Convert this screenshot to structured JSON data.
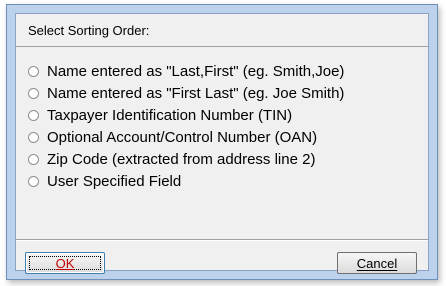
{
  "dialog": {
    "title": "Select Sorting Order:"
  },
  "options": [
    {
      "label": "Name entered as \"Last,First\" (eg. Smith,Joe)",
      "selected": false
    },
    {
      "label": "Name entered as \"First Last\" (eg. Joe Smith)",
      "selected": false
    },
    {
      "label": "Taxpayer Identification Number (TIN)",
      "selected": false
    },
    {
      "label": "Optional Account/Control Number (OAN)",
      "selected": false
    },
    {
      "label": "Zip Code (extracted from address line 2)",
      "selected": false
    },
    {
      "label": "User Specified Field",
      "selected": false
    }
  ],
  "buttons": {
    "ok_label": "OK",
    "cancel_label": "Cancel"
  },
  "colors": {
    "frame": "#bcd2ec",
    "ok_text": "#c00000"
  }
}
